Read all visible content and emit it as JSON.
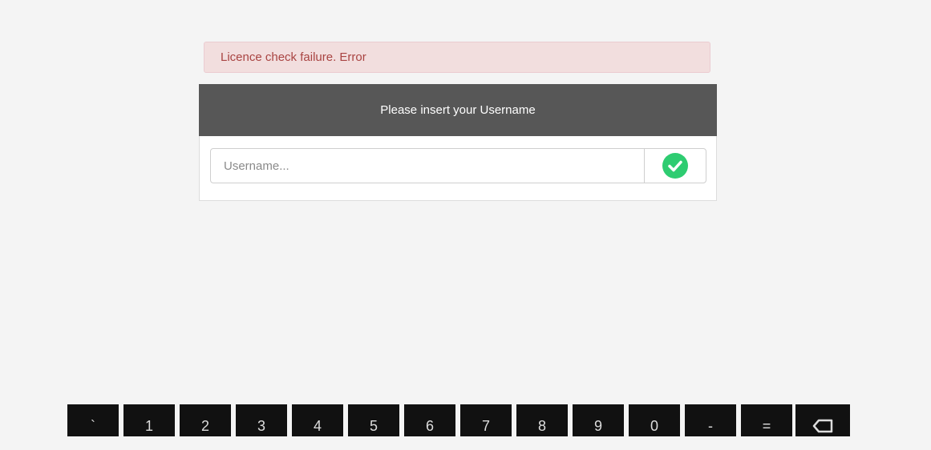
{
  "alert": {
    "message": "Licence check failure. Error"
  },
  "login_panel": {
    "title": "Please insert your Username",
    "username_placeholder": "Username...",
    "username_value": "",
    "confirm_icon": "check-circle-icon"
  },
  "keyboard": {
    "keys": [
      "`",
      "1",
      "2",
      "3",
      "4",
      "5",
      "6",
      "7",
      "8",
      "9",
      "0",
      "-",
      "=",
      "backspace"
    ]
  },
  "colors": {
    "confirm_green": "#2ecc71",
    "alert_text": "#a94442",
    "alert_bg": "#f2dede",
    "header_bg": "#575757",
    "key_bg": "#111111"
  }
}
